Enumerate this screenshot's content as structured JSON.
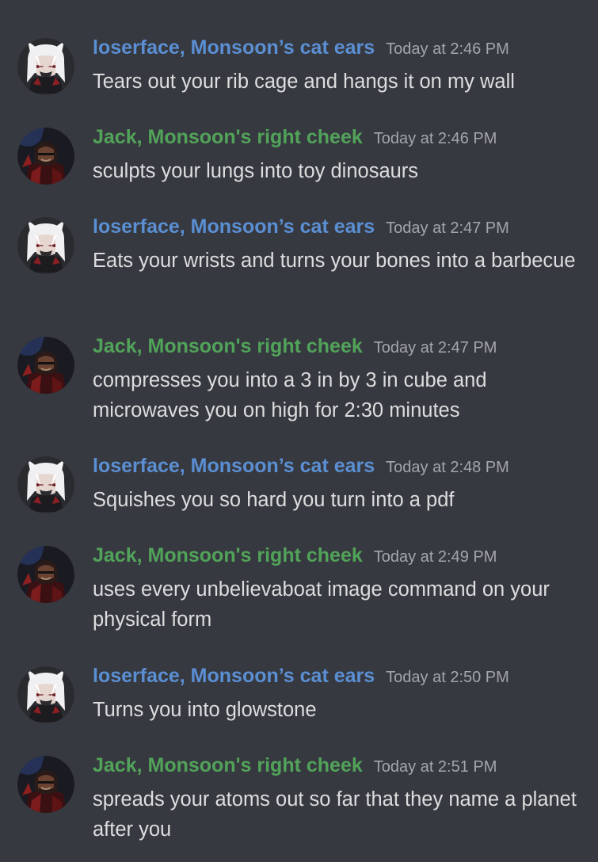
{
  "colors": {
    "background": "#36393f",
    "loserface_name": "#5b8fd4",
    "jack_name": "#52a35a",
    "timestamp": "#a3a6aa",
    "text": "#dcddde"
  },
  "messages": [
    {
      "author": "loserface, Monsoon’s cat ears",
      "avatar": "white-hair-anime-avatar-icon",
      "time": "Today at 2:46 PM",
      "text": "Tears out your rib cage and hangs it on my wall"
    },
    {
      "author": "Jack, Monsoon's right cheek",
      "avatar": "dark-hooded-figure-avatar-icon",
      "time": "Today at 2:46 PM",
      "text": "sculpts your lungs into toy dinosaurs"
    },
    {
      "author": "loserface, Monsoon’s cat ears",
      "avatar": "white-hair-anime-avatar-icon",
      "time": "Today at 2:47 PM",
      "text": "Eats your wrists and turns your bones into a barbecue"
    },
    {
      "author": "Jack, Monsoon's right cheek",
      "avatar": "dark-hooded-figure-avatar-icon",
      "time": "Today at 2:47 PM",
      "text": "compresses you into a 3 in by 3 in cube and microwaves you on high for 2:30 minutes"
    },
    {
      "author": "loserface, Monsoon’s cat ears",
      "avatar": "white-hair-anime-avatar-icon",
      "time": "Today at 2:48 PM",
      "text": "Squishes you so hard you turn into a pdf"
    },
    {
      "author": "Jack, Monsoon's right cheek",
      "avatar": "dark-hooded-figure-avatar-icon",
      "time": "Today at 2:49 PM",
      "text": "uses every unbelievaboat image command on your physical form"
    },
    {
      "author": "loserface, Monsoon’s cat ears",
      "avatar": "white-hair-anime-avatar-icon",
      "time": "Today at 2:50 PM",
      "text": "Turns you into glowstone"
    },
    {
      "author": "Jack, Monsoon's right cheek",
      "avatar": "dark-hooded-figure-avatar-icon",
      "time": "Today at 2:51 PM",
      "text": "spreads your atoms out so far that they name a planet after you"
    }
  ]
}
